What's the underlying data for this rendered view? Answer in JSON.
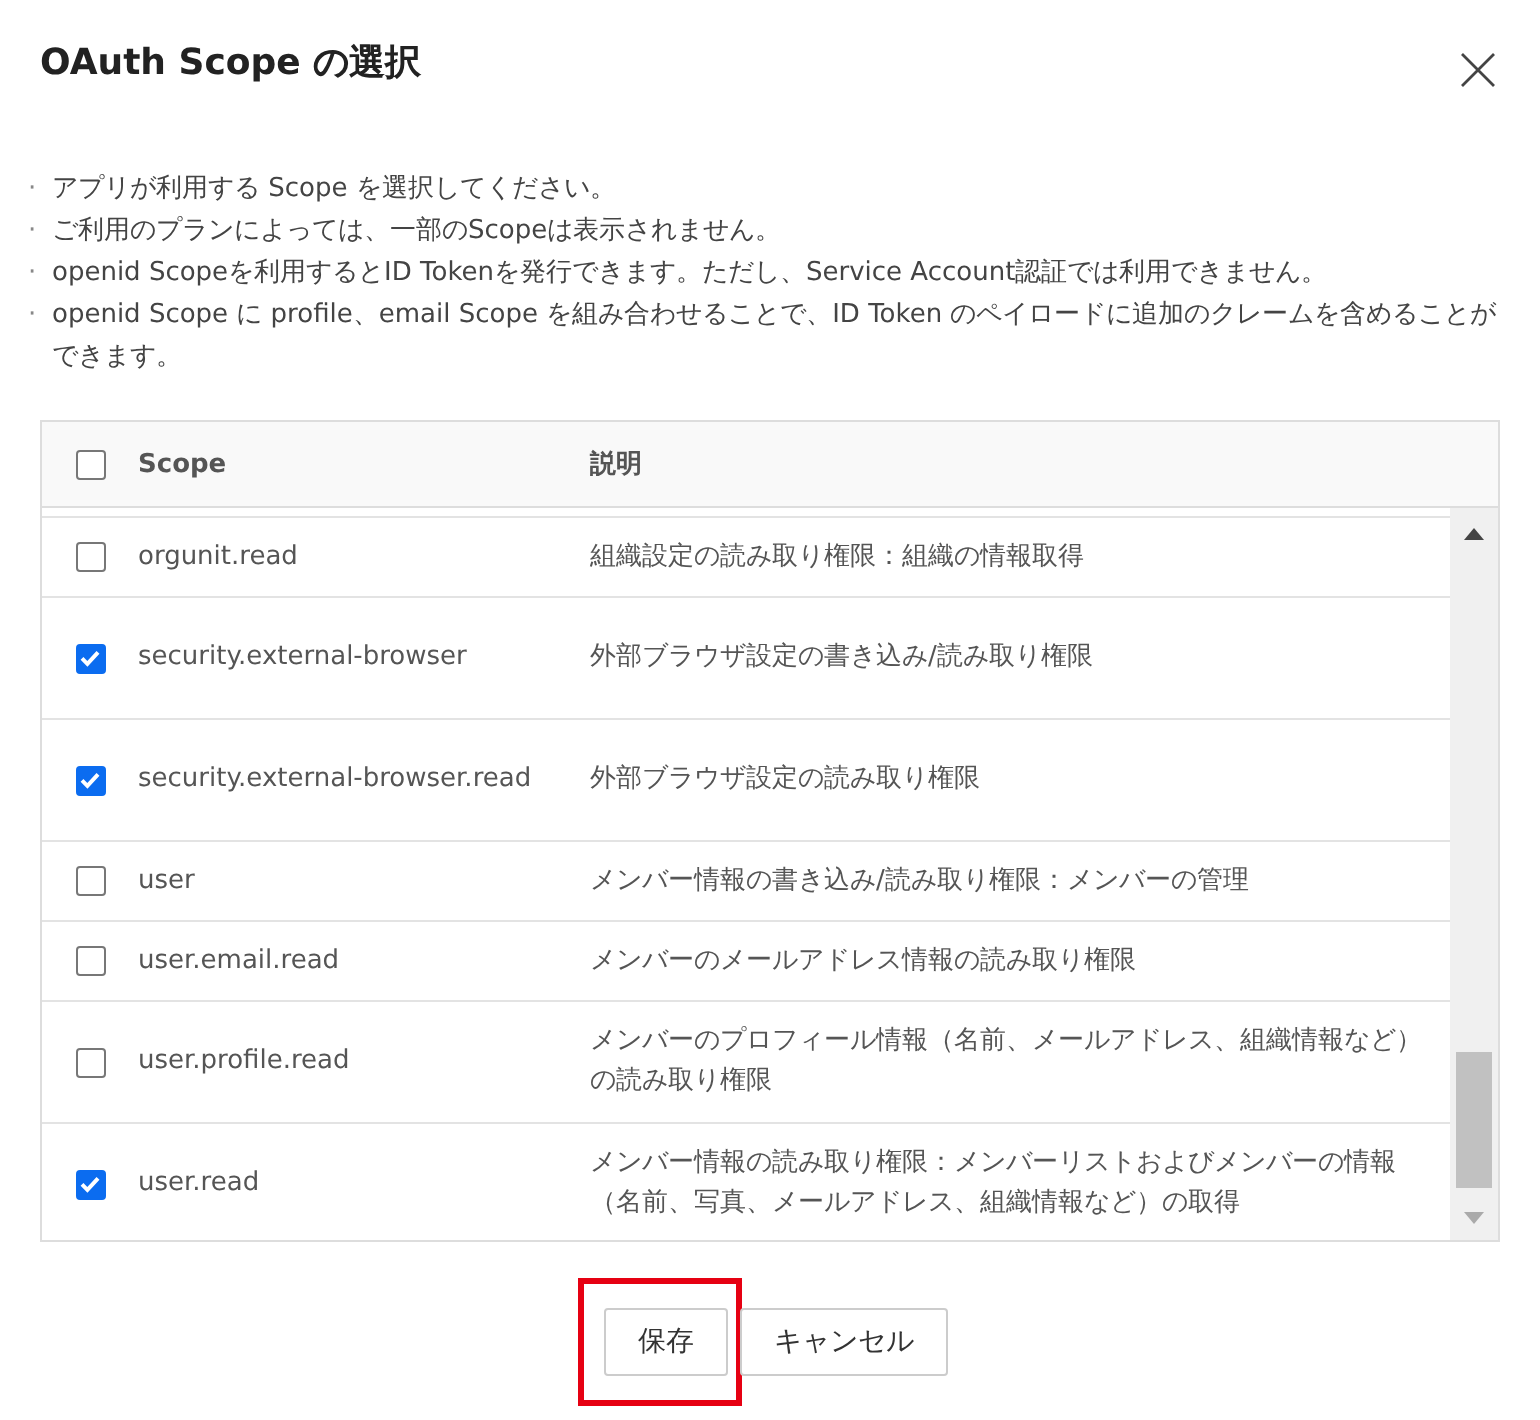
{
  "dialog": {
    "title": "OAuth Scope の選択"
  },
  "notes": [
    {
      "bullet": "·",
      "text": "アプリが利用する Scope を選択してください。"
    },
    {
      "bullet": "·",
      "text": "ご利用のプランによっては、一部のScopeは表示されません。"
    },
    {
      "bullet": "·",
      "text": "openid Scopeを利用するとID Tokenを発行できます。ただし、Service Account認証では利用できません。"
    },
    {
      "bullet": "·",
      "text": "openid Scope に profile、email Scope を組み合わせることで、ID Token のペイロードに追加のクレームを含めることができます。"
    }
  ],
  "table": {
    "select_all_checked": false,
    "columns": [
      "Scope",
      "説明"
    ],
    "rows": [
      {
        "scope": "orgunit.read",
        "description": "組織設定の読み取り権限：組織の情報取得",
        "checked": false
      },
      {
        "scope": "security.external-browser",
        "description": "外部ブラウザ設定の書き込み/読み取り権限",
        "checked": true
      },
      {
        "scope": "security.external-browser.read",
        "description": "外部ブラウザ設定の読み取り権限",
        "checked": true
      },
      {
        "scope": "user",
        "description": "メンバー情報の書き込み/読み取り権限：メンバーの管理",
        "checked": false
      },
      {
        "scope": "user.email.read",
        "description": "メンバーのメールアドレス情報の読み取り権限",
        "checked": false
      },
      {
        "scope": "user.profile.read",
        "description": "メンバーのプロフィール情報（名前、メールアドレス、組織情報など）の読み取り権限",
        "checked": false
      },
      {
        "scope": "user.read",
        "description": "メンバー情報の読み取り権限：メンバーリストおよびメンバーの情報（名前、写真、メールアドレス、組織情報など）の取得",
        "checked": true
      }
    ]
  },
  "buttons": [
    {
      "label": "保存",
      "highlighted": true
    },
    {
      "label": "キャンセル",
      "highlighted": false
    }
  ]
}
